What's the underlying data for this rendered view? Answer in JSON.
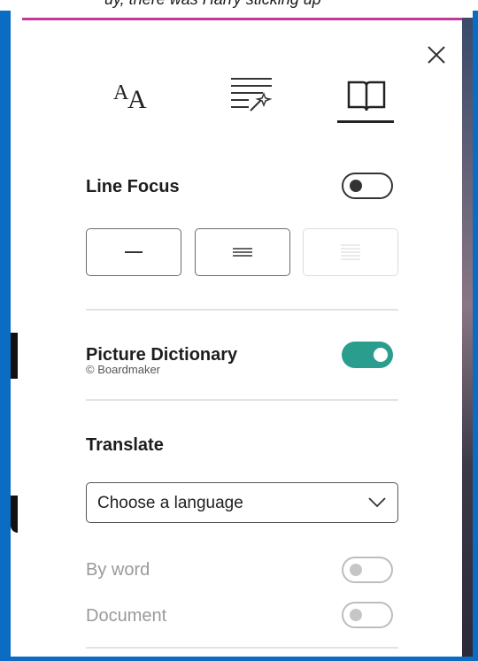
{
  "window": {
    "top_strip_text": "uy, there was Harry sticking up",
    "accent_color": "#c2399b",
    "frame_color": "#0a6cc2"
  },
  "tabs": [
    {
      "icon": "text-size-icon",
      "selected": false
    },
    {
      "icon": "grammar-wand-icon",
      "selected": false
    },
    {
      "icon": "book-icon",
      "selected": true
    }
  ],
  "line_focus": {
    "label": "Line Focus",
    "enabled": false,
    "options": [
      {
        "icon": "one-line-icon",
        "disabled": false
      },
      {
        "icon": "three-lines-icon",
        "disabled": false
      },
      {
        "icon": "five-lines-icon",
        "disabled": true
      }
    ]
  },
  "picture_dictionary": {
    "label": "Picture Dictionary",
    "credit": "© Boardmaker",
    "enabled": true,
    "toggle_color": "#2a9d8f"
  },
  "translate": {
    "label": "Translate",
    "select_value": "Choose a language",
    "by_word_label": "By word",
    "document_label": "Document",
    "by_word_enabled": false,
    "document_enabled": false
  }
}
